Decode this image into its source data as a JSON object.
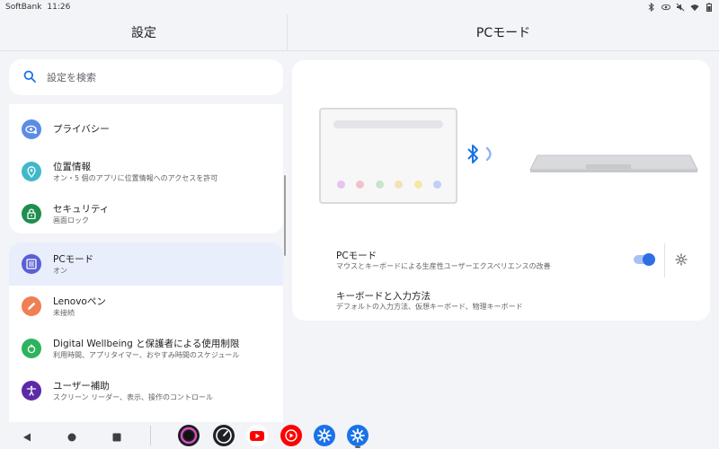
{
  "status_bar": {
    "carrier": "SoftBank",
    "time": "11:26",
    "icons": [
      "bluetooth-icon",
      "eye-icon",
      "mute-icon",
      "wifi-icon",
      "battery-icon"
    ]
  },
  "header": {
    "left_title": "設定",
    "right_title": "PCモード"
  },
  "search": {
    "placeholder": "設定を検索"
  },
  "menu": {
    "items": [
      {
        "title": "プライバシー",
        "subtitle": "",
        "icon": "eye-icon",
        "color": "#5b8ce6"
      },
      {
        "title": "位置情報",
        "subtitle": "オン・5 個のアプリに位置情報へのアクセスを許可",
        "icon": "location-icon",
        "color": "#3fb8c9"
      },
      {
        "title": "セキュリティ",
        "subtitle": "画面ロック",
        "icon": "lock-icon",
        "color": "#1e8e4e"
      },
      {
        "title": "PCモード",
        "subtitle": "オン",
        "icon": "pc-mode-icon",
        "color": "#5b5fd6"
      },
      {
        "title": "Lenovoペン",
        "subtitle": "未接続",
        "icon": "pen-icon",
        "color": "#f07f54"
      },
      {
        "title": "Digital Wellbeing と保護者による使用制限",
        "subtitle": "利用時間、アプリタイマー、おやすみ時間のスケジュール",
        "icon": "wellbeing-icon",
        "color": "#2db35d"
      },
      {
        "title": "ユーザー補助",
        "subtitle": "スクリーン リーダー、表示、操作のコントロール",
        "icon": "accessibility-icon",
        "color": "#5c2aa8"
      }
    ]
  },
  "pc_mode": {
    "toggle_title": "PCモード",
    "toggle_subtitle": "マウスとキーボードによる生産性ユーザーエクスペリエンスの改善",
    "toggle_on": true,
    "keyboard_title": "キーボードと入力方法",
    "keyboard_subtitle": "デフォルトの入力方法、仮想キーボード、物理キーボード"
  },
  "illustration": {
    "dot_colors": [
      "#e7c3ef",
      "#f4c0cb",
      "#c7e5c9",
      "#f6e0b5",
      "#f7e7a6",
      "#c0cff4"
    ]
  },
  "dock": {
    "apps": [
      "camera-app-icon",
      "speedometer-app-icon",
      "youtube-app-icon",
      "youtube-music-app-icon",
      "settings-app-icon",
      "settings-app-icon-active"
    ]
  }
}
